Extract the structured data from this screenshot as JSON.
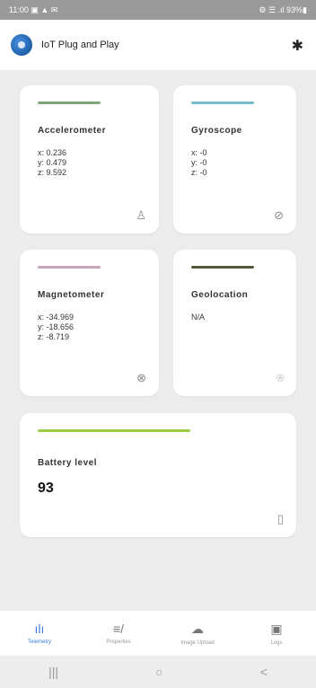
{
  "status_bar": {
    "time": "11:00",
    "left_icons": "▣ ▲ ✉",
    "right_text": "⚙ ☰ .ıl 93%▮"
  },
  "header": {
    "title": "IoT Plug and Play",
    "settings_icon": "gear-icon",
    "settings_glyph": "✱"
  },
  "cards": {
    "accelerometer": {
      "title": "Accelerometer",
      "color": "#7fa67a",
      "values": [
        "x: 0.236",
        "y: 0.479",
        "z: 9.592"
      ],
      "icon": "person-icon",
      "icon_glyph": "♙"
    },
    "gyroscope": {
      "title": "Gyroscope",
      "color": "#7bbbd0",
      "values": [
        "x: -0",
        "y: -0",
        "z: -0"
      ],
      "icon": "compass-icon",
      "icon_glyph": "⊘"
    },
    "magnetometer": {
      "title": "Magnetometer",
      "color": "#c8a5bf",
      "values": [
        "x: -34.969",
        "y: -18.656",
        "z: -8.719"
      ],
      "icon": "magnet-icon",
      "icon_glyph": "⊗"
    },
    "geolocation": {
      "title": "Geolocation",
      "color": "#555a3c",
      "value": "N/A",
      "icon": "location-pin-icon",
      "icon_glyph": "⌾"
    },
    "battery": {
      "title": "Battery level",
      "color": "#9ccc46",
      "value": "93",
      "icon": "battery-icon",
      "icon_glyph": "▯"
    }
  },
  "bottom_nav": [
    {
      "label": "Telemetry",
      "icon": "bar-chart-icon",
      "glyph": "ılı"
    },
    {
      "label": "Properties",
      "icon": "edit-list-icon",
      "glyph": "≡/"
    },
    {
      "label": "Image Upload",
      "icon": "cloud-upload-icon",
      "glyph": "☁"
    },
    {
      "label": "Logs",
      "icon": "terminal-icon",
      "glyph": "▣"
    }
  ],
  "system_nav": {
    "recents": "|||",
    "home": "○",
    "back": "<"
  }
}
